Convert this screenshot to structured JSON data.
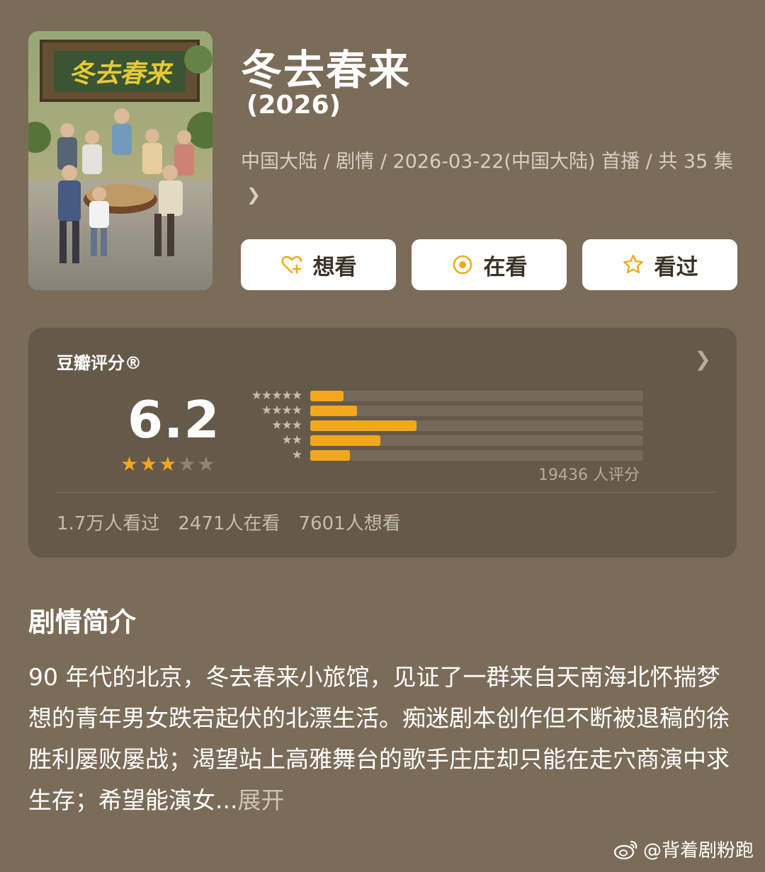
{
  "title": "冬去春来",
  "year": "(2026)",
  "meta": "中国大陆 / 剧情 / 2026-03-22(中国大陆) 首播 / 共 35 集",
  "poster": {
    "title_text": "冬去春来"
  },
  "buttons": {
    "want": "想看",
    "watching": "在看",
    "watched": "看过"
  },
  "rating": {
    "label": "豆瓣评分®",
    "score": "6.2",
    "stars": 3,
    "star_rows": [
      "★★★★★",
      "★★★★",
      "★★★",
      "★★",
      "★"
    ],
    "distribution": [
      0.1,
      0.14,
      0.32,
      0.21,
      0.12
    ],
    "count_text": "19436 人评分",
    "stats": {
      "watched": "1.7万人看过",
      "watching": "2471人在看",
      "want": "7601人想看"
    }
  },
  "synopsis": {
    "heading": "剧情简介",
    "text": "90 年代的北京，冬去春来小旅馆，见证了一群来自天南海北怀揣梦想的青年男女跌宕起伏的北漂生活。痴迷剧本创作但不断被退稿的徐胜利屡败屡战；渴望站上高雅舞台的歌手庄庄却只能在走穴商演中求生存；希望能演女...",
    "expand": "展开"
  },
  "watermark": "@背着剧粉跑",
  "colors": {
    "background": "#7a6c58",
    "card": "#65594a",
    "accent": "#f3a81c",
    "button_bg": "#ffffff"
  },
  "icons": [
    "heart-plus-icon",
    "target-icon",
    "star-outline-icon",
    "chevron-right-icon",
    "weibo-icon"
  ]
}
